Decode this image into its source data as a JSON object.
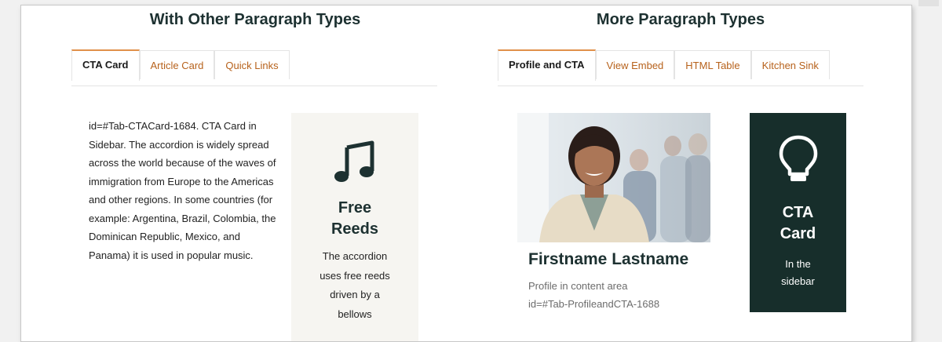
{
  "left_section": {
    "heading": "With Other Paragraph Types",
    "tabs": [
      {
        "label": "CTA Card"
      },
      {
        "label": "Article Card"
      },
      {
        "label": "Quick Links"
      }
    ],
    "body_text": "id=#Tab-CTACard-1684. CTA Card in Sidebar. The accordion is widely spread across the world because of the waves of immigration from Europe to the Americas and other regions. In some countries (for example: Argentina, Brazil, Colombia, the Dominican Republic, Mexico, and Panama) it is used in popular music.",
    "cta_card": {
      "icon": "music-note-icon",
      "title_line1": "Free",
      "title_line2": "Reeds",
      "text_line1": "The accordion",
      "text_line2": "uses free reeds",
      "text_line3": "driven by a",
      "text_line4": "bellows",
      "background": "#f6f5f1"
    }
  },
  "right_section": {
    "heading": "More Paragraph Types",
    "tabs": [
      {
        "label": "Profile and CTA"
      },
      {
        "label": "View Embed"
      },
      {
        "label": "HTML Table"
      },
      {
        "label": "Kitchen Sink"
      }
    ],
    "profile": {
      "name": "Firstname Lastname",
      "desc_line1": "Profile in content area",
      "desc_line2": "id=#Tab-ProfileandCTA-1688"
    },
    "cta_card": {
      "icon": "lightbulb-icon",
      "title_line1": "CTA",
      "title_line2": "Card",
      "text_line1": "In the",
      "text_line2": "sidebar",
      "background": "#172e2b"
    }
  },
  "colors": {
    "tab_link": "#b7621c",
    "tab_active_border": "#e0904a",
    "heading": "#1d3131"
  }
}
